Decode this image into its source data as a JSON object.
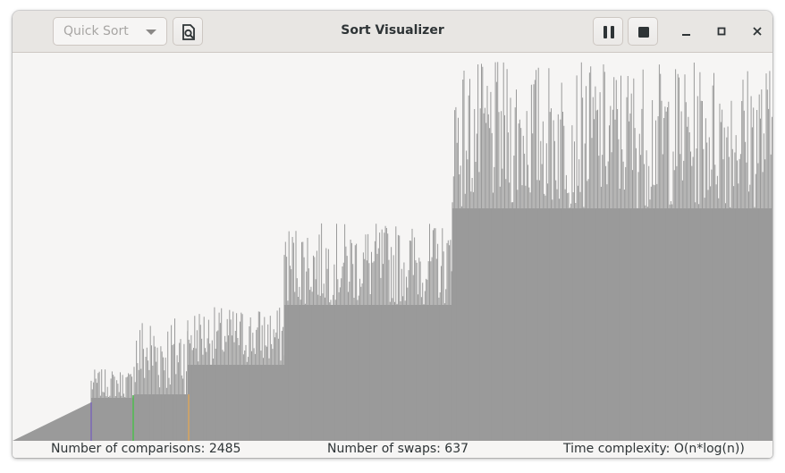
{
  "window": {
    "title": "Sort Visualizer"
  },
  "header": {
    "algorithm_select": {
      "selected": "Quick Sort"
    },
    "icons": {
      "shuffle": "file-search-icon",
      "pause": "pause-icon",
      "stop": "stop-icon",
      "minimize": "minimize-icon",
      "maximize": "maximize-icon",
      "close": "close-icon"
    }
  },
  "colors": {
    "bar": "#9a9a9a",
    "highlight_pivot": "#7b68b8",
    "highlight_compare": "#4ebd4e",
    "highlight_swap": "#d9a55e"
  },
  "status": {
    "comparisons": "Number of comparisons: 2485",
    "swaps": "Number of swaps: 637",
    "complexity": "Time complexity: O(n*log(n))"
  }
}
